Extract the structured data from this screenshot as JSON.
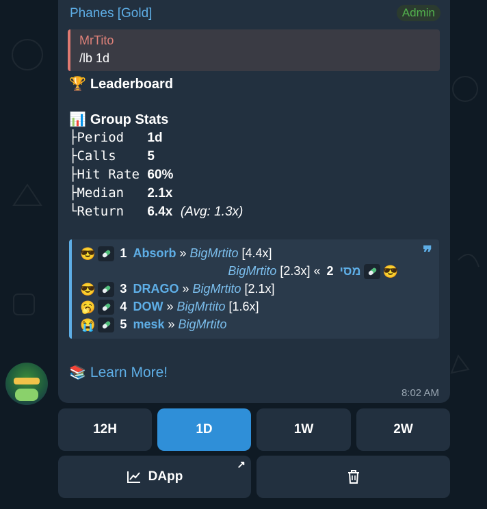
{
  "message": {
    "sender": "Phanes [Gold]",
    "badge": "Admin",
    "reply": {
      "author": "MrTito",
      "text": "/lb 1d"
    },
    "leaderboard_title": "Leaderboard",
    "leaderboard_icon": "🏆",
    "stats_title": "Group Stats",
    "stats_icon": "📊",
    "stats": [
      {
        "prefix": "├Period   ",
        "value": "1d",
        "extra": ""
      },
      {
        "prefix": "├Calls    ",
        "value": "5",
        "extra": ""
      },
      {
        "prefix": "├Hit Rate ",
        "value": "60%",
        "extra": ""
      },
      {
        "prefix": "├Median   ",
        "value": "2.1x",
        "extra": ""
      },
      {
        "prefix": "└Return   ",
        "value": "6.4x",
        "extra": "(Avg: 1.3x)"
      }
    ],
    "entries": [
      {
        "face": "😎",
        "rank": "1",
        "name": "Absorb",
        "sep": " » ",
        "caller": "BigMrtito",
        "mult": "[4.4x]"
      },
      {
        "face": "😎",
        "rank": "2",
        "name": "מסי",
        "sep": " « ",
        "caller": "BigMrtito",
        "mult": "[2.3x]"
      },
      {
        "face": "😎",
        "rank": "3",
        "name": "DRAGO",
        "sep": " » ",
        "caller": "BigMrtito",
        "mult": "[2.1x]"
      },
      {
        "face": "🥱",
        "rank": "4",
        "name": "DOW",
        "sep": " » ",
        "caller": "BigMrtito",
        "mult": "[1.6x]"
      },
      {
        "face": "😭",
        "rank": "5",
        "name": "mesk",
        "sep": " » ",
        "caller": "BigMrtito",
        "mult": ""
      }
    ],
    "learn_icon": "📚",
    "learn_more": "Learn More!",
    "time": "8:02 AM"
  },
  "keyboard": {
    "periods": [
      {
        "label": "12H",
        "active": false
      },
      {
        "label": "1D",
        "active": true
      },
      {
        "label": "1W",
        "active": false
      },
      {
        "label": "2W",
        "active": false
      }
    ],
    "dapp_label": "DApp",
    "dapp_icon": "chart-trend-icon",
    "delete_icon": "trash-icon",
    "active_color": "#2f8fd8"
  }
}
